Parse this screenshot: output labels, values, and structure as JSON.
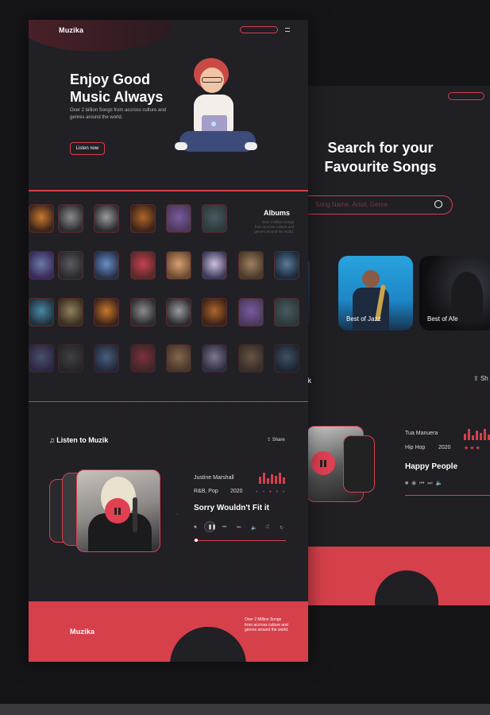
{
  "hero": {
    "logo": "Muzika",
    "title_line1": "Enjoy Good",
    "title_line2": "Music Always",
    "subtitle": "Over 2 billion Songs from accross culture and genres around the world.",
    "cta": "Listen now"
  },
  "albums": {
    "title": "Albums",
    "description": "Over 2 billion Songs from accross culture and genres around the world."
  },
  "player": {
    "heading": "Listen to Muzik",
    "share": "Share",
    "artist": "Justine Marshall",
    "genre": "R&B, Pop",
    "year": "2020",
    "song": "Sorry Wouldn't Fit it"
  },
  "footer": {
    "logo": "Muzika",
    "text": "Over 2 Million Songs from accross culture and genres around the world."
  },
  "search_page": {
    "title_line1": "Search for your",
    "title_line2": "Favourite Songs",
    "search_placeholder": "Song Name, Artist, Genre",
    "cards": [
      {
        "label": ""
      },
      {
        "label": "Best of Jazz"
      },
      {
        "label": "Best of Afe"
      }
    ],
    "muzik_label": "zik",
    "share": "Sh",
    "artist": "Tua Manuera",
    "genre": "Hip Hop",
    "year": "2020",
    "song": "Happy People"
  },
  "colors": {
    "accent": "#d6404b",
    "panel": "#202025",
    "background": "#151518"
  }
}
